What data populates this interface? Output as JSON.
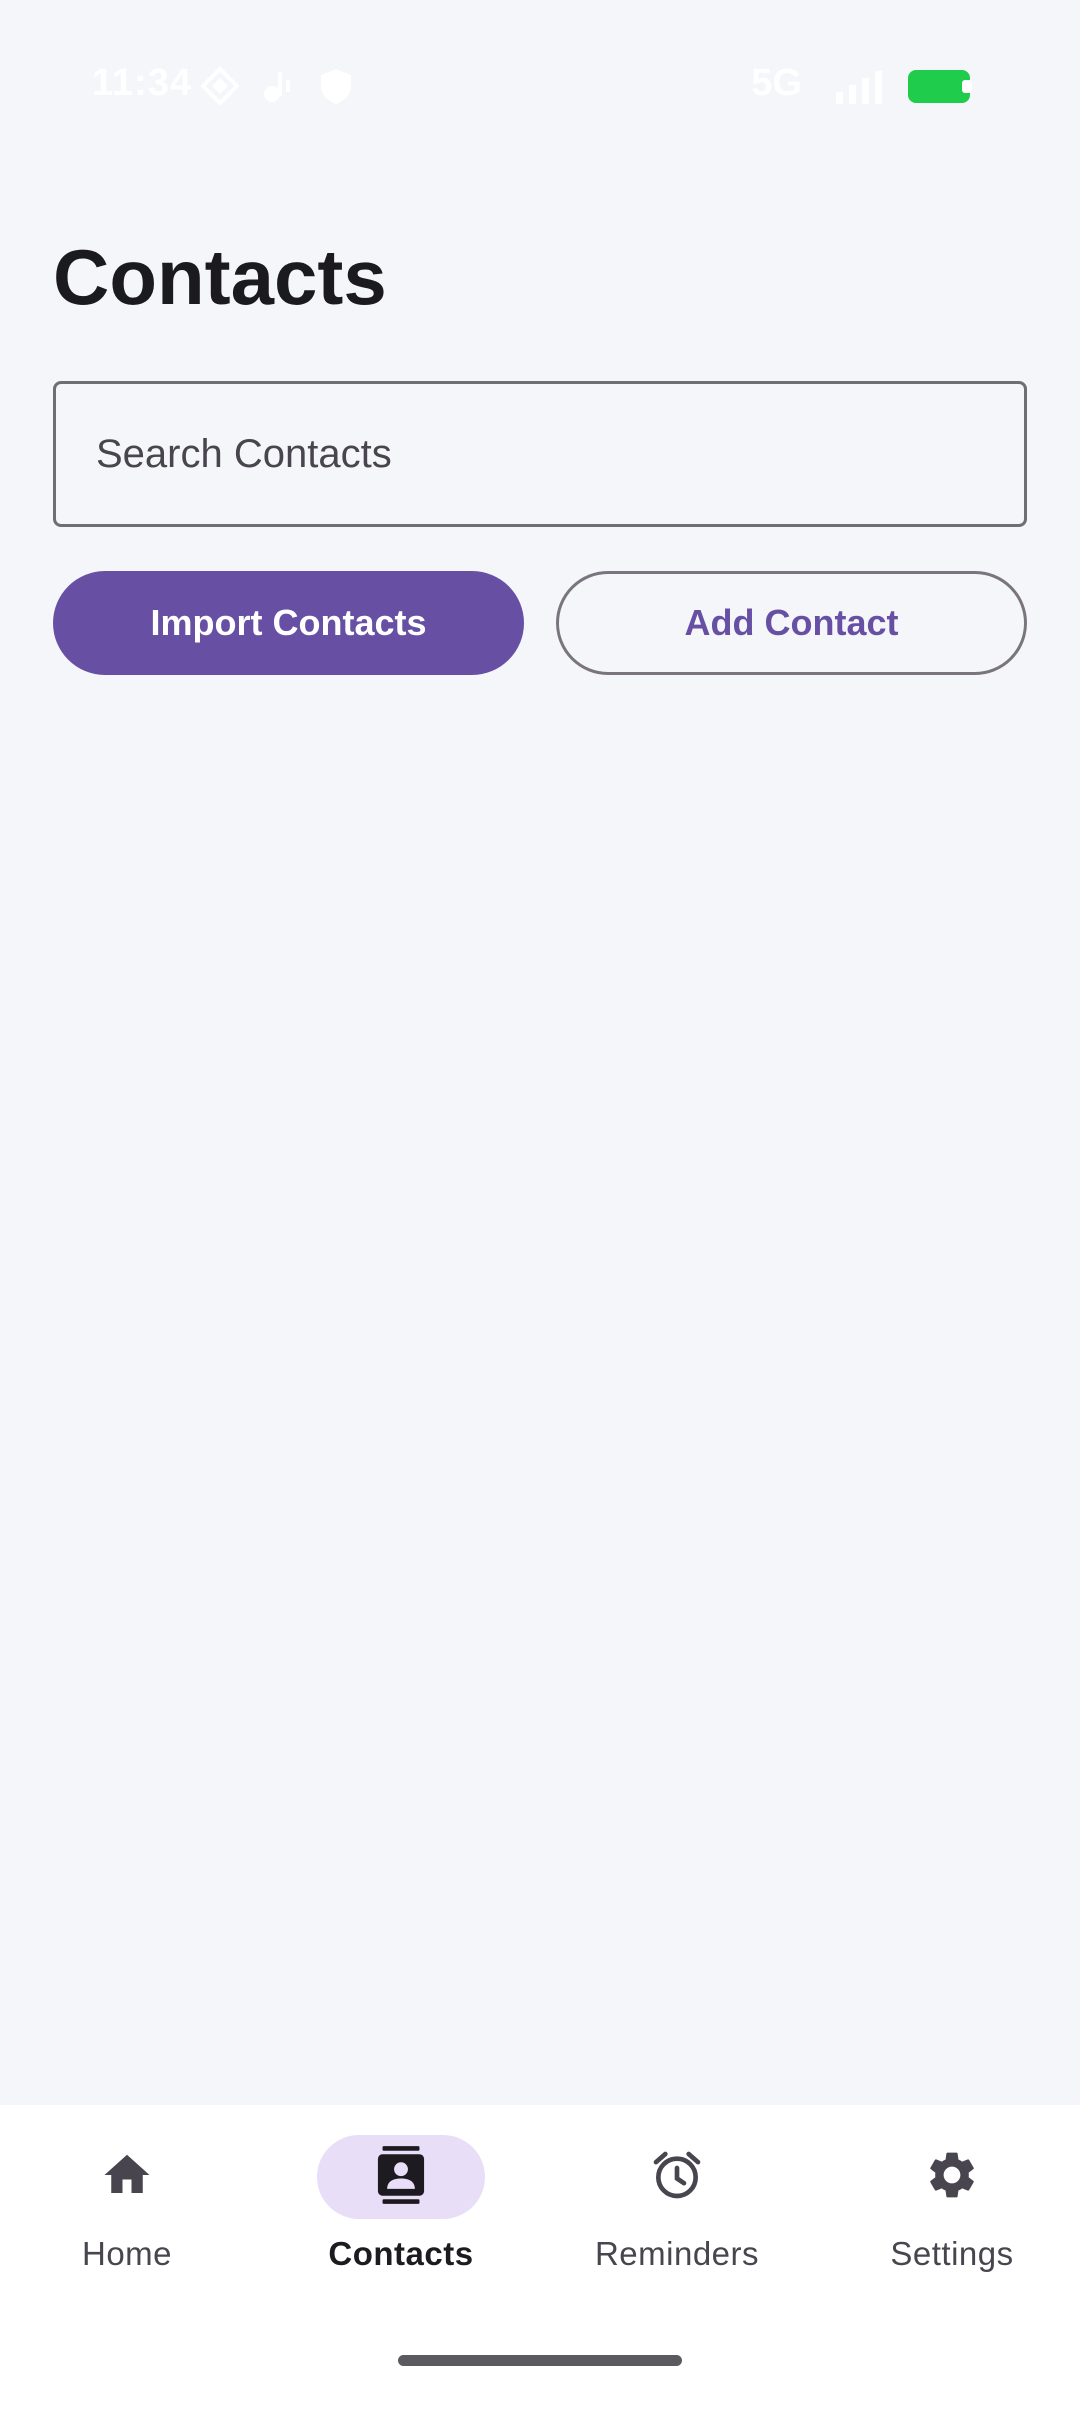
{
  "status_bar": {
    "time": "11:34",
    "network": "5G",
    "battery_color": "#1fcc4b"
  },
  "header": {
    "title": "Contacts"
  },
  "search": {
    "placeholder": "Search Contacts"
  },
  "actions": {
    "import_label": "Import Contacts",
    "add_label": "Add Contact"
  },
  "bottom_nav": {
    "items": [
      {
        "label": "Home",
        "icon": "home-icon",
        "active": false
      },
      {
        "label": "Contacts",
        "icon": "contacts-icon",
        "active": true
      },
      {
        "label": "Reminders",
        "icon": "alarm-icon",
        "active": false
      },
      {
        "label": "Settings",
        "icon": "gear-icon",
        "active": false
      }
    ]
  },
  "colors": {
    "primary": "#6750a4",
    "background": "#f5f6fa",
    "active_indicator": "#e8def8"
  }
}
